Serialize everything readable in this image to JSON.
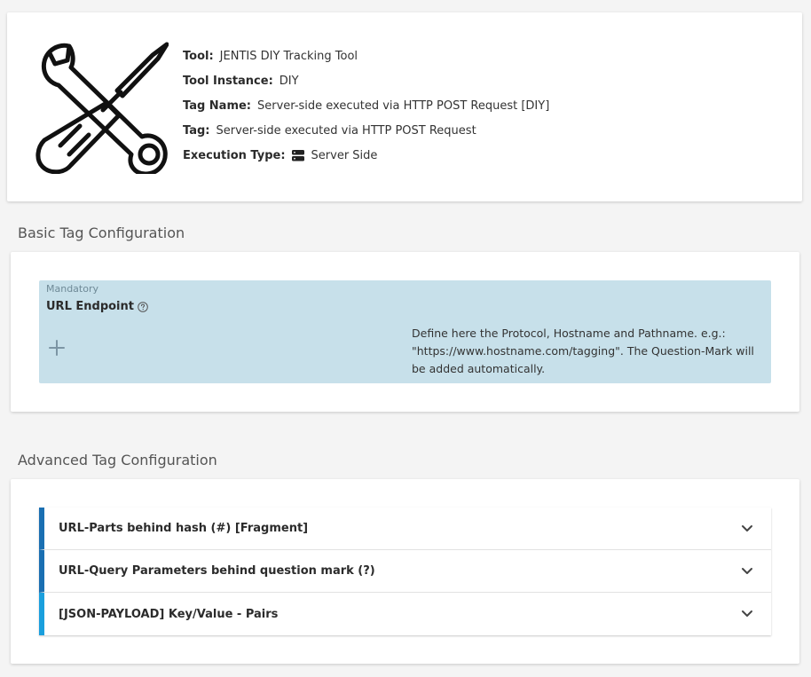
{
  "info": {
    "tool_label": "Tool:",
    "tool_value": "JENTIS DIY Tracking Tool",
    "instance_label": "Tool Instance:",
    "instance_value": "DIY",
    "tagname_label": "Tag Name:",
    "tagname_value": "Server-side executed via HTTP POST Request [DIY]",
    "tag_label": "Tag:",
    "tag_value": "Server-side executed via HTTP POST Request",
    "exec_label": "Execution Type:",
    "exec_value": "Server Side",
    "logo_icon": "wrench-screwdriver-icon",
    "exec_icon": "server-icon"
  },
  "basic": {
    "title": "Basic Tag Configuration",
    "mandatory_tag": "Mandatory",
    "field_label": "URL Endpoint",
    "help_icon": "question-circle-icon",
    "add_icon": "plus-icon",
    "description": "Define here the Protocol, Hostname and Pathname. e.g.: \"https://www.hostname.com/tagging\". The Question-Mark will be added automatically.",
    "box_color": "#c7e0ea"
  },
  "advanced": {
    "title": "Advanced Tag Configuration",
    "items": [
      {
        "label": "URL-Parts behind hash (#) [Fragment]",
        "accent": "#1a6fb2"
      },
      {
        "label": "URL-Query Parameters behind question mark (?)",
        "accent": "#1a6fb2"
      },
      {
        "label": "[JSON-PAYLOAD] Key/Value - Pairs",
        "accent": "#1a9fdd"
      }
    ],
    "chevron_icon": "chevron-down-icon"
  }
}
